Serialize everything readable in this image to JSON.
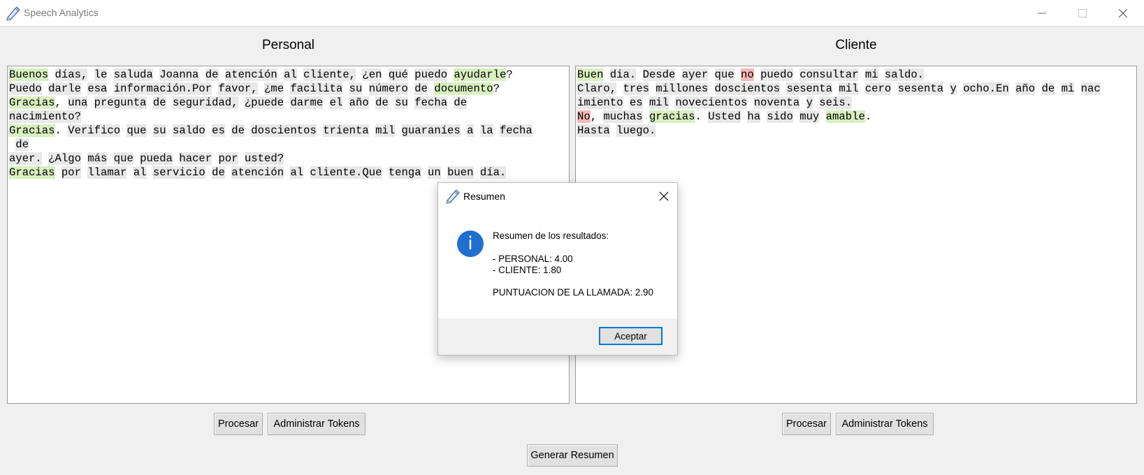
{
  "window": {
    "title": "Speech Analytics"
  },
  "panels": {
    "personal": {
      "title": "Personal",
      "lines": [
        [
          [
            "Buenos",
            "pos"
          ],
          [
            " "
          ],
          [
            "días,",
            "tok"
          ],
          [
            " "
          ],
          [
            "le",
            "tok"
          ],
          [
            " "
          ],
          [
            "saluda",
            "tok"
          ],
          [
            " "
          ],
          [
            "Joanna",
            "tok"
          ],
          [
            " "
          ],
          [
            "de",
            "tok"
          ],
          [
            " "
          ],
          [
            "atención",
            "tok"
          ],
          [
            " "
          ],
          [
            "al",
            "tok"
          ],
          [
            " "
          ],
          [
            "cliente,",
            "tok"
          ],
          [
            " "
          ],
          [
            "¿en",
            "tok"
          ],
          [
            " "
          ],
          [
            "qué",
            "tok"
          ],
          [
            " "
          ],
          [
            "puedo",
            "tok"
          ],
          [
            " "
          ],
          [
            "ayudarle",
            "pos"
          ],
          [
            "?"
          ]
        ],
        [
          [
            "Puedo",
            "tok"
          ],
          [
            " "
          ],
          [
            "darle",
            "tok"
          ],
          [
            " "
          ],
          [
            "esa",
            "tok"
          ],
          [
            " "
          ],
          [
            "información.Por",
            "tok"
          ],
          [
            " "
          ],
          [
            "favor,",
            "tok"
          ],
          [
            " "
          ],
          [
            "¿me",
            "tok"
          ],
          [
            " "
          ],
          [
            "facilita",
            "tok"
          ],
          [
            " "
          ],
          [
            "su",
            "tok"
          ],
          [
            " "
          ],
          [
            "número",
            "tok"
          ],
          [
            " "
          ],
          [
            "de",
            "tok"
          ],
          [
            " "
          ],
          [
            "documento",
            "pos"
          ],
          [
            "?"
          ]
        ],
        [
          [
            "Gracias",
            "pos"
          ],
          [
            ", "
          ],
          [
            "una",
            "tok"
          ],
          [
            " "
          ],
          [
            "pregunta",
            "tok"
          ],
          [
            " "
          ],
          [
            "de",
            "tok"
          ],
          [
            " "
          ],
          [
            "seguridad,",
            "tok"
          ],
          [
            " "
          ],
          [
            "¿puede",
            "tok"
          ],
          [
            " "
          ],
          [
            "darme",
            "tok"
          ],
          [
            " "
          ],
          [
            "el",
            "tok"
          ],
          [
            " "
          ],
          [
            "año",
            "tok"
          ],
          [
            " "
          ],
          [
            "de",
            "tok"
          ],
          [
            " "
          ],
          [
            "su",
            "tok"
          ],
          [
            " "
          ],
          [
            "fecha",
            "tok"
          ],
          [
            " "
          ],
          [
            "de",
            "tok"
          ]
        ],
        [
          [
            "nacimiento?",
            "tok"
          ]
        ],
        [
          [
            "Gracias",
            "pos"
          ],
          [
            ". "
          ],
          [
            "Verifico",
            "tok"
          ],
          [
            " "
          ],
          [
            "que",
            "tok"
          ],
          [
            " "
          ],
          [
            "su",
            "tok"
          ],
          [
            " "
          ],
          [
            "saldo",
            "tok"
          ],
          [
            " "
          ],
          [
            "es",
            "tok"
          ],
          [
            " "
          ],
          [
            "de",
            "tok"
          ],
          [
            " "
          ],
          [
            "doscientos",
            "tok"
          ],
          [
            " "
          ],
          [
            "trienta",
            "tok"
          ],
          [
            " "
          ],
          [
            "mil",
            "tok"
          ],
          [
            " "
          ],
          [
            "guaraníes",
            "tok"
          ],
          [
            " "
          ],
          [
            "a",
            "tok"
          ],
          [
            " "
          ],
          [
            "la",
            "tok"
          ],
          [
            " "
          ],
          [
            "fecha",
            "tok"
          ]
        ],
        [
          [
            " "
          ],
          [
            "de",
            "tok"
          ]
        ],
        [
          [
            "ayer.",
            "tok"
          ],
          [
            " "
          ],
          [
            "¿Algo",
            "tok"
          ],
          [
            " "
          ],
          [
            "más",
            "tok"
          ],
          [
            " "
          ],
          [
            "que",
            "tok"
          ],
          [
            " "
          ],
          [
            "pueda",
            "tok"
          ],
          [
            " "
          ],
          [
            "hacer",
            "tok"
          ],
          [
            " "
          ],
          [
            "por",
            "tok"
          ],
          [
            " "
          ],
          [
            "usted?",
            "tok"
          ]
        ],
        [
          [
            "Gracias",
            "pos"
          ],
          [
            " "
          ],
          [
            "por",
            "tok"
          ],
          [
            " "
          ],
          [
            "llamar",
            "tok"
          ],
          [
            " "
          ],
          [
            "al",
            "tok"
          ],
          [
            " "
          ],
          [
            "servicio",
            "tok"
          ],
          [
            " "
          ],
          [
            "de",
            "tok"
          ],
          [
            " "
          ],
          [
            "atención",
            "tok"
          ],
          [
            " "
          ],
          [
            "al",
            "tok"
          ],
          [
            " "
          ],
          [
            "cliente.Que",
            "tok"
          ],
          [
            " "
          ],
          [
            "tenga",
            "tok"
          ],
          [
            " "
          ],
          [
            "un",
            "tok"
          ],
          [
            " "
          ],
          [
            "buen",
            "tok"
          ],
          [
            " "
          ],
          [
            "día.",
            "tok"
          ]
        ]
      ],
      "process_label": "Procesar",
      "tokens_label": "Administrar Tokens"
    },
    "cliente": {
      "title": "Cliente",
      "lines": [
        [
          [
            "Buen",
            "pos"
          ],
          [
            " "
          ],
          [
            "dia.",
            "tok"
          ],
          [
            " "
          ],
          [
            "Desde",
            "tok"
          ],
          [
            " "
          ],
          [
            "ayer",
            "tok"
          ],
          [
            " "
          ],
          [
            "que",
            "tok"
          ],
          [
            " "
          ],
          [
            "no",
            "neg"
          ],
          [
            " "
          ],
          [
            "puedo",
            "tok"
          ],
          [
            " "
          ],
          [
            "consultar",
            "tok"
          ],
          [
            " "
          ],
          [
            "mi",
            "tok"
          ],
          [
            " "
          ],
          [
            "saldo.",
            "tok"
          ]
        ],
        [
          [
            "Claro,",
            "tok"
          ],
          [
            " "
          ],
          [
            "tres",
            "tok"
          ],
          [
            " "
          ],
          [
            "millones",
            "tok"
          ],
          [
            " "
          ],
          [
            "doscientos",
            "tok"
          ],
          [
            " "
          ],
          [
            "sesenta",
            "tok"
          ],
          [
            " "
          ],
          [
            "mil",
            "tok"
          ],
          [
            " "
          ],
          [
            "cero",
            "tok"
          ],
          [
            " "
          ],
          [
            "sesenta",
            "tok"
          ],
          [
            " "
          ],
          [
            "y",
            "tok"
          ],
          [
            " "
          ],
          [
            "ocho.En",
            "tok"
          ],
          [
            " "
          ],
          [
            "año",
            "tok"
          ],
          [
            " "
          ],
          [
            "de",
            "tok"
          ],
          [
            " "
          ],
          [
            "mi",
            "tok"
          ],
          [
            " "
          ],
          [
            "nac",
            "tok"
          ]
        ],
        [
          [
            "imiento",
            "tok"
          ],
          [
            " "
          ],
          [
            "es",
            "tok"
          ],
          [
            " "
          ],
          [
            "mil",
            "tok"
          ],
          [
            " "
          ],
          [
            "novecientos",
            "tok"
          ],
          [
            " "
          ],
          [
            "noventa",
            "tok"
          ],
          [
            " "
          ],
          [
            "y",
            "tok"
          ],
          [
            " "
          ],
          [
            "seis.",
            "tok"
          ]
        ],
        [
          [
            "No",
            "neg"
          ],
          [
            ", "
          ],
          [
            "muchas",
            "tok"
          ],
          [
            " "
          ],
          [
            "gracias",
            "pos"
          ],
          [
            ". "
          ],
          [
            "Usted",
            "tok"
          ],
          [
            " "
          ],
          [
            "ha",
            "tok"
          ],
          [
            " "
          ],
          [
            "sido",
            "tok"
          ],
          [
            " "
          ],
          [
            "muy",
            "tok"
          ],
          [
            " "
          ],
          [
            "amable",
            "pos"
          ],
          [
            "."
          ]
        ],
        [
          [
            "Hasta",
            "tok"
          ],
          [
            " "
          ],
          [
            "luego.",
            "tok"
          ]
        ]
      ],
      "process_label": "Procesar",
      "tokens_label": "Administrar Tokens"
    }
  },
  "summary_button": "Generar Resumen",
  "dialog": {
    "title": "Resumen",
    "heading": "Resumen de los resultados:",
    "personal": "- PERSONAL: 4.00",
    "cliente": "- CLIENTE: 1.80",
    "score": "PUNTUACION DE LA LLAMADA: 2.90",
    "ok_label": "Aceptar",
    "icon": "info-icon"
  },
  "colors": {
    "positive": "#d8f0c0",
    "negative": "#f6b8b8",
    "token": "#e8e8e8",
    "accent": "#0078d7"
  }
}
